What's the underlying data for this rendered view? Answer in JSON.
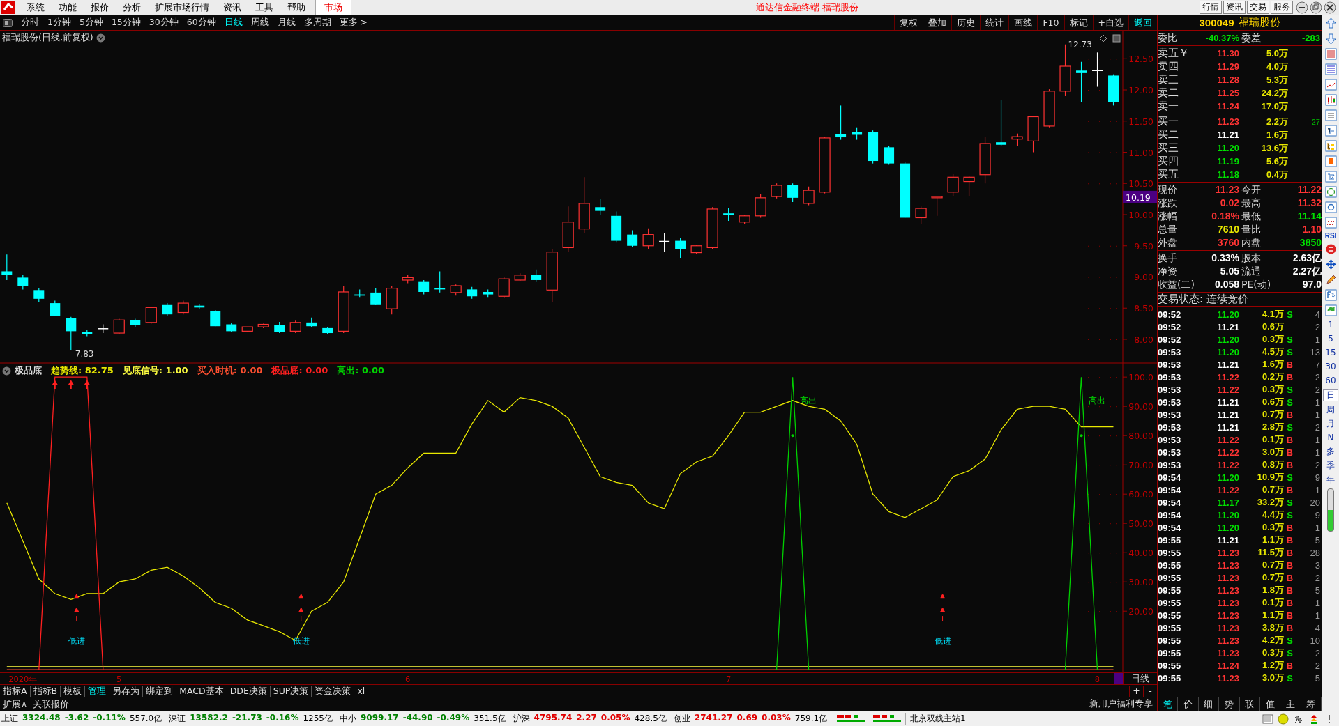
{
  "menu_bar": {
    "items": [
      "系统",
      "功能",
      "报价",
      "分析",
      "扩展市场行情",
      "资讯",
      "工具",
      "帮助"
    ],
    "market": "市场",
    "title": "通达信金融终端  福瑞股份",
    "buttons": [
      "行情",
      "资讯",
      "交易",
      "服务"
    ]
  },
  "period_bar": {
    "periods": [
      {
        "label": "分时",
        "selected": false
      },
      {
        "label": "1分钟",
        "selected": false
      },
      {
        "label": "5分钟",
        "selected": false
      },
      {
        "label": "15分钟",
        "selected": false
      },
      {
        "label": "30分钟",
        "selected": false
      },
      {
        "label": "60分钟",
        "selected": false
      },
      {
        "label": "日线",
        "selected": true
      },
      {
        "label": "周线",
        "selected": false
      },
      {
        "label": "月线",
        "selected": false
      },
      {
        "label": "多周期",
        "selected": false
      },
      {
        "label": "更多 >",
        "selected": false
      }
    ],
    "tools": [
      {
        "label": "复权",
        "selected": false
      },
      {
        "label": "叠加",
        "selected": false
      },
      {
        "label": "历史",
        "selected": false
      },
      {
        "label": "统计",
        "selected": false
      },
      {
        "label": "画线",
        "selected": false
      },
      {
        "label": "F10",
        "selected": false
      },
      {
        "label": "标记",
        "selected": false
      },
      {
        "label": "+自选",
        "selected": false
      },
      {
        "label": "返回",
        "selected": true
      }
    ]
  },
  "price_chart": {
    "title": "福瑞股份(日线,前复权)",
    "high_label": "12.73",
    "low_label": "7.83",
    "current_label": "10.19",
    "chart_data": {
      "type": "candlestick",
      "ylim": [
        7.62,
        12.95
      ],
      "yticks": [
        {
          "value": 8,
          "label": "8.00"
        },
        {
          "value": 8.5,
          "label": "8.50"
        },
        {
          "value": 9,
          "label": "9.00"
        },
        {
          "value": 9.5,
          "label": "9.50"
        },
        {
          "value": 10,
          "label": "10.00"
        },
        {
          "value": 10.5,
          "label": "10.50"
        },
        {
          "value": 11,
          "label": "11.00"
        },
        {
          "value": 11.5,
          "label": "11.50"
        },
        {
          "value": 12,
          "label": "12.00"
        },
        {
          "value": 12.5,
          "label": "12.50"
        }
      ],
      "categories": [
        null,
        null,
        null,
        null,
        null,
        null,
        null,
        null,
        null,
        null,
        null,
        null,
        null,
        null,
        null,
        null,
        null,
        null,
        null,
        null,
        null,
        null,
        null,
        null,
        null,
        null,
        null,
        null,
        null,
        null,
        null,
        null,
        null,
        null,
        null,
        null,
        null,
        null,
        null,
        null,
        null,
        null,
        null,
        null,
        null,
        null,
        null,
        null,
        null,
        null,
        null,
        null,
        null,
        null,
        null,
        null,
        null,
        null,
        null,
        null,
        null,
        null,
        null,
        null,
        null,
        null,
        null,
        null,
        null,
        null
      ],
      "ohlc": [
        [
          9.09,
          9.36,
          8.95,
          9.03
        ],
        [
          8.99,
          9.03,
          8.8,
          8.86
        ],
        [
          8.79,
          8.82,
          8.6,
          8.65
        ],
        [
          8.58,
          8.62,
          8.38,
          8.38
        ],
        [
          8.34,
          8.36,
          7.83,
          8.13
        ],
        [
          8.12,
          8.15,
          8.05,
          8.08
        ],
        [
          8.17,
          8.24,
          8.1,
          8.17
        ],
        [
          8.1,
          8.33,
          8.08,
          8.31
        ],
        [
          8.31,
          8.33,
          8.2,
          8.23
        ],
        [
          8.27,
          8.52,
          8.25,
          8.51
        ],
        [
          8.55,
          8.58,
          8.38,
          8.4
        ],
        [
          8.43,
          8.62,
          8.4,
          8.58
        ],
        [
          8.54,
          8.57,
          8.48,
          8.51
        ],
        [
          8.45,
          8.47,
          8.21,
          8.21
        ],
        [
          8.24,
          8.26,
          8.12,
          8.13
        ],
        [
          8.13,
          8.2,
          8.12,
          8.2
        ],
        [
          8.2,
          8.25,
          8.18,
          8.24
        ],
        [
          8.23,
          8.28,
          8.1,
          8.12
        ],
        [
          8.13,
          8.3,
          8.1,
          8.27
        ],
        [
          8.27,
          8.35,
          8.2,
          8.21
        ],
        [
          8.18,
          8.2,
          8.08,
          8.1
        ],
        [
          8.13,
          8.85,
          8.1,
          8.76
        ],
        [
          8.72,
          8.8,
          8.68,
          8.7
        ],
        [
          8.75,
          8.82,
          8.55,
          8.55
        ],
        [
          8.49,
          8.86,
          8.4,
          8.82
        ],
        [
          8.95,
          9.03,
          8.9,
          8.99
        ],
        [
          8.92,
          8.95,
          8.72,
          8.76
        ],
        [
          8.82,
          9.09,
          8.75,
          8.8
        ],
        [
          8.75,
          8.88,
          8.7,
          8.86
        ],
        [
          8.8,
          8.84,
          8.65,
          8.69
        ],
        [
          8.76,
          8.8,
          8.68,
          8.72
        ],
        [
          8.69,
          9.0,
          8.67,
          8.97
        ],
        [
          8.95,
          9.06,
          8.93,
          9.03
        ],
        [
          9.03,
          9.12,
          8.92,
          8.95
        ],
        [
          8.79,
          9.45,
          8.6,
          9.4
        ],
        [
          9.47,
          10.13,
          9.4,
          9.88
        ],
        [
          9.77,
          10.6,
          9.7,
          10.18
        ],
        [
          10.12,
          10.25,
          10.0,
          10.06
        ],
        [
          9.98,
          10.05,
          9.55,
          9.58
        ],
        [
          9.68,
          9.75,
          9.48,
          9.5
        ],
        [
          9.5,
          9.78,
          9.45,
          9.68
        ],
        [
          9.57,
          9.7,
          9.4,
          9.57
        ],
        [
          9.58,
          9.62,
          9.3,
          9.45
        ],
        [
          9.39,
          9.52,
          9.37,
          9.5
        ],
        [
          9.47,
          10.12,
          9.45,
          10.09
        ],
        [
          10.02,
          10.1,
          9.9,
          9.99
        ],
        [
          9.88,
          10.0,
          9.85,
          9.98
        ],
        [
          9.98,
          10.33,
          9.95,
          10.27
        ],
        [
          10.29,
          10.5,
          10.26,
          10.47
        ],
        [
          10.47,
          10.5,
          10.2,
          10.27
        ],
        [
          10.18,
          10.45,
          10.15,
          10.39
        ],
        [
          10.36,
          11.25,
          10.34,
          11.23
        ],
        [
          11.29,
          11.75,
          11.2,
          11.24
        ],
        [
          11.32,
          11.4,
          11.2,
          11.28
        ],
        [
          11.32,
          11.35,
          10.82,
          10.86
        ],
        [
          11.08,
          11.1,
          10.8,
          10.82
        ],
        [
          10.82,
          10.85,
          9.95,
          9.95
        ],
        [
          9.95,
          10.13,
          9.85,
          10.1
        ],
        [
          10.27,
          10.3,
          9.98,
          10.29
        ],
        [
          10.36,
          10.65,
          10.3,
          10.6
        ],
        [
          10.53,
          10.62,
          10.3,
          10.6
        ],
        [
          10.64,
          11.25,
          10.5,
          11.14
        ],
        [
          11.16,
          11.84,
          11.1,
          11.12
        ],
        [
          11.21,
          11.3,
          11.1,
          11.25
        ],
        [
          11.18,
          11.57,
          11.0,
          11.57
        ],
        [
          11.42,
          12.01,
          11.4,
          11.98
        ],
        [
          11.98,
          12.73,
          11.9,
          12.38
        ],
        [
          12.31,
          12.45,
          11.8,
          12.27
        ],
        [
          12.31,
          12.6,
          12.05,
          12.31
        ],
        [
          12.23,
          12.25,
          11.75,
          11.8
        ]
      ]
    }
  },
  "indicator": {
    "name": "极品底",
    "readouts": [
      ": 82.75",
      ": 1.00",
      ": 0.00",
      ": 0.00",
      ": 0.00"
    ],
    "chart_data": {
      "type": "line",
      "ylim": [
        -0.9,
        104.8
      ],
      "yticks": [
        {
          "value": 20,
          "label": "20.00"
        },
        {
          "value": 30,
          "label": "30.00"
        },
        {
          "value": 40,
          "label": "40.00"
        },
        {
          "value": 50,
          "label": "50.00"
        },
        {
          "value": 60,
          "label": "60.00"
        },
        {
          "value": 70,
          "label": "70.00"
        },
        {
          "value": 80,
          "label": "80.00"
        },
        {
          "value": 90,
          "label": "90.00"
        },
        {
          "value": 100,
          "label": "100.0"
        }
      ],
      "categories": [
        null,
        "2020年",
        null,
        null,
        null,
        null,
        null,
        "5",
        null,
        null,
        null,
        null,
        null,
        null,
        null,
        null,
        null,
        null,
        null,
        null,
        null,
        null,
        null,
        null,
        null,
        "6",
        null,
        null,
        null,
        null,
        null,
        null,
        null,
        null,
        null,
        null,
        null,
        null,
        null,
        null,
        null,
        null,
        null,
        null,
        null,
        "7",
        null,
        null,
        null,
        null,
        null,
        null,
        null,
        null,
        null,
        null,
        null,
        null,
        null,
        null,
        null,
        null,
        null,
        null,
        null,
        null,
        null,
        null,
        "8",
        null
      ],
      "series": [
        {
          "name": "趋势线",
          "color": "#e8e800",
          "values": [
            57,
            44,
            31,
            26,
            24,
            26,
            26,
            30,
            31,
            34,
            35,
            32,
            28,
            23,
            21,
            17,
            15,
            13,
            10,
            20,
            23,
            30,
            45,
            60,
            63,
            69,
            74,
            74,
            74,
            84,
            92,
            88,
            93,
            92,
            90,
            86,
            76,
            66,
            64,
            63,
            57,
            55,
            67,
            71,
            73,
            80,
            88,
            88,
            90,
            92,
            90,
            89,
            85,
            77,
            60,
            54,
            52,
            55,
            58,
            66,
            68,
            72,
            82,
            89,
            90,
            90,
            89,
            83,
            83,
            83
          ]
        },
        {
          "name": "见底信号",
          "color": "#ffff40",
          "values": [
            1,
            1,
            1,
            1,
            1,
            1,
            1,
            1,
            1,
            1,
            1,
            1,
            1,
            1,
            1,
            1,
            1,
            1,
            1,
            1,
            1,
            1,
            1,
            1,
            1,
            1,
            1,
            1,
            1,
            1,
            1,
            1,
            1,
            1,
            1,
            1,
            1,
            1,
            1,
            1,
            1,
            1,
            1,
            1,
            1,
            1,
            1,
            1,
            1,
            1,
            1,
            1,
            1,
            1,
            1,
            1,
            1,
            1,
            1,
            1,
            1,
            1,
            1,
            1,
            1,
            1,
            1,
            1,
            1,
            1
          ]
        },
        {
          "name": "买入时机",
          "color": "#ff5030",
          "values": [
            0,
            0,
            0,
            0,
            0,
            0,
            0,
            0,
            0,
            0,
            0,
            0,
            0,
            0,
            0,
            0,
            0,
            0,
            0,
            0,
            0,
            0,
            0,
            0,
            0,
            0,
            0,
            0,
            0,
            0,
            0,
            0,
            0,
            0,
            0,
            0,
            0,
            0,
            0,
            0,
            0,
            0,
            0,
            0,
            0,
            0,
            0,
            0,
            0,
            0,
            0,
            0,
            0,
            0,
            0,
            0,
            0,
            0,
            0,
            0,
            0,
            0,
            0,
            0,
            0,
            0,
            0,
            0,
            0,
            0
          ]
        },
        {
          "name": "极品底",
          "color": "#ff2020",
          "values": [
            null,
            null,
            0,
            100,
            100,
            100,
            0,
            null,
            null,
            null,
            null,
            null,
            null,
            null,
            null,
            null,
            null,
            null,
            null,
            null,
            null,
            null,
            null,
            null,
            null,
            null,
            null,
            null,
            null,
            null,
            null,
            null,
            null,
            null,
            null,
            null,
            null,
            null,
            null,
            null,
            null,
            null,
            null,
            null,
            null,
            null,
            null,
            null,
            null,
            null,
            null,
            null,
            null,
            null,
            null,
            null,
            null,
            null,
            null,
            null,
            null,
            null,
            null,
            null,
            null,
            null,
            null,
            null,
            null,
            null
          ]
        },
        {
          "name": "高出",
          "color": "#00d000",
          "values": [
            null,
            null,
            null,
            null,
            null,
            null,
            null,
            null,
            null,
            null,
            null,
            null,
            null,
            null,
            null,
            null,
            null,
            null,
            null,
            null,
            null,
            null,
            null,
            null,
            null,
            null,
            null,
            null,
            null,
            null,
            null,
            null,
            null,
            null,
            null,
            null,
            null,
            null,
            null,
            null,
            null,
            null,
            null,
            null,
            null,
            null,
            null,
            null,
            0,
            100,
            0,
            null,
            null,
            null,
            null,
            null,
            null,
            null,
            null,
            null,
            null,
            null,
            null,
            null,
            null,
            null,
            0,
            100,
            0,
            null
          ]
        }
      ],
      "annotations": [
        "低进",
        "低进",
        "低进",
        "高出",
        "高出"
      ]
    }
  },
  "date_axis": {
    "scroll": "--",
    "period": "日线",
    "zoom_in": "+",
    "zoom_out": "-"
  },
  "bottom_tabs": [
    {
      "label": "指标A",
      "selected": false
    },
    {
      "label": "指标B",
      "selected": false
    },
    {
      "label": "模板",
      "selected": false
    },
    {
      "label": "管理",
      "selected": true
    },
    {
      "label": "另存为",
      "selected": false
    },
    {
      "label": "绑定到",
      "selected": false
    },
    {
      "label": "MACD基本",
      "selected": false
    },
    {
      "label": "DDE决策",
      "selected": false
    },
    {
      "label": "SUP决策",
      "selected": false
    },
    {
      "label": "资金决策",
      "selected": false
    },
    {
      "label": "xl",
      "selected": false
    }
  ],
  "extra_tabs": [
    "扩展∧",
    "关联报价"
  ],
  "promo": "新用户福利专享",
  "quote": {
    "code": "300049",
    "name": "福瑞股份",
    "ratio_label": "委比",
    "ratio": "-40.37%",
    "diff_label": "委差",
    "diff": "-283",
    "asks": [
      {
        "label": "卖五￥",
        "price": "11.30",
        "color": "#ff3434",
        "volume": "5.0万"
      },
      {
        "label": "卖四",
        "price": "11.29",
        "color": "#ff3434",
        "volume": "4.0万"
      },
      {
        "label": "卖三",
        "price": "11.28",
        "color": "#ff3434",
        "volume": "5.3万"
      },
      {
        "label": "卖二",
        "price": "11.25",
        "color": "#ff3434",
        "volume": "24.2万"
      },
      {
        "label": "卖一",
        "price": "11.24",
        "color": "#ff3434",
        "volume": "17.0万"
      }
    ],
    "bids": [
      {
        "label": "买一",
        "price": "11.23",
        "color": "#ff3434",
        "volume": "2.2万",
        "change": "-27"
      },
      {
        "label": "买二",
        "price": "11.21",
        "color": "#ffffff",
        "volume": "1.6万"
      },
      {
        "label": "买三",
        "price": "11.20",
        "color": "#00e000",
        "volume": "13.6万"
      },
      {
        "label": "买四",
        "price": "11.19",
        "color": "#00e000",
        "volume": "5.6万"
      },
      {
        "label": "买五",
        "price": "11.18",
        "color": "#00e000",
        "volume": "0.4万"
      }
    ],
    "stats": [
      {
        "label": "现价",
        "value": "11.23",
        "color": "#ff3434"
      },
      {
        "label": "今开",
        "value": "11.22",
        "color": "#ff3434"
      },
      {
        "label": "涨跌",
        "value": "0.02",
        "color": "#ff3434"
      },
      {
        "label": "最高",
        "value": "11.32",
        "color": "#ff3434"
      },
      {
        "label": "涨幅",
        "value": "0.18%",
        "color": "#ff3434"
      },
      {
        "label": "最低",
        "value": "11.14",
        "color": "#00e000"
      },
      {
        "label": "总量",
        "value": "7610",
        "color": "#e8e800"
      },
      {
        "label": "量比",
        "value": "1.10",
        "color": "#ff3434"
      },
      {
        "label": "外盘",
        "value": "3760",
        "color": "#ff3434"
      },
      {
        "label": "内盘",
        "value": "3850",
        "color": "#00e000"
      }
    ],
    "stats2": [
      {
        "label": "换手",
        "value": "0.33%",
        "color": "#ffffff"
      },
      {
        "label": "股本",
        "value": "2.63亿",
        "color": "#ffffff"
      },
      {
        "label": "净资",
        "value": "5.05",
        "color": "#ffffff"
      },
      {
        "label": "流通",
        "value": "2.27亿",
        "color": "#ffffff"
      },
      {
        "label": "收益(二)",
        "value": "0.058",
        "color": "#ffffff"
      },
      {
        "label": "PE(动)",
        "value": "97.0",
        "color": "#ffffff"
      }
    ],
    "status": "交易状态: 连续竞价"
  },
  "ticks": [
    {
      "time": "09:52",
      "price": "11.20",
      "color": "#00e000",
      "volume": "4.1万",
      "side": {
        "text": "S",
        "color": "#00e000"
      },
      "count": "4"
    },
    {
      "time": "09:52",
      "price": "11.21",
      "color": "#ffffff",
      "volume": "0.6万",
      "count": "2"
    },
    {
      "time": "09:52",
      "price": "11.20",
      "color": "#00e000",
      "volume": "0.3万",
      "side": {
        "text": "S",
        "color": "#00e000"
      },
      "count": "1"
    },
    {
      "time": "09:53",
      "price": "11.20",
      "color": "#00e000",
      "volume": "4.5万",
      "side": {
        "text": "S",
        "color": "#00e000"
      },
      "count": "13"
    },
    {
      "time": "09:53",
      "price": "11.21",
      "color": "#ffffff",
      "volume": "1.6万",
      "side": {
        "text": "B",
        "color": "#ff3434"
      },
      "count": "7"
    },
    {
      "time": "09:53",
      "price": "11.22",
      "color": "#ff3434",
      "volume": "0.2万",
      "side": {
        "text": "B",
        "color": "#ff3434"
      },
      "count": "2"
    },
    {
      "time": "09:53",
      "price": "11.22",
      "color": "#ff3434",
      "volume": "0.3万",
      "side": {
        "text": "S",
        "color": "#00e000"
      },
      "count": "2"
    },
    {
      "time": "09:53",
      "price": "11.21",
      "color": "#ffffff",
      "volume": "0.6万",
      "side": {
        "text": "S",
        "color": "#00e000"
      },
      "count": "1"
    },
    {
      "time": "09:53",
      "price": "11.21",
      "color": "#ffffff",
      "volume": "0.7万",
      "side": {
        "text": "B",
        "color": "#ff3434"
      },
      "count": "1"
    },
    {
      "time": "09:53",
      "price": "11.21",
      "color": "#ffffff",
      "volume": "2.8万",
      "side": {
        "text": "S",
        "color": "#00e000"
      },
      "count": "2"
    },
    {
      "time": "09:53",
      "price": "11.22",
      "color": "#ff3434",
      "volume": "0.1万",
      "side": {
        "text": "B",
        "color": "#ff3434"
      },
      "count": "1"
    },
    {
      "time": "09:53",
      "price": "11.22",
      "color": "#ff3434",
      "volume": "3.0万",
      "side": {
        "text": "B",
        "color": "#ff3434"
      },
      "count": "1"
    },
    {
      "time": "09:53",
      "price": "11.22",
      "color": "#ff3434",
      "volume": "0.8万",
      "side": {
        "text": "B",
        "color": "#ff3434"
      },
      "count": "2"
    },
    {
      "time": "09:54",
      "price": "11.20",
      "color": "#00e000",
      "volume": "10.9万",
      "side": {
        "text": "S",
        "color": "#00e000"
      },
      "count": "9"
    },
    {
      "time": "09:54",
      "price": "11.22",
      "color": "#ff3434",
      "volume": "0.7万",
      "side": {
        "text": "B",
        "color": "#ff3434"
      },
      "count": "1"
    },
    {
      "time": "09:54",
      "price": "11.17",
      "color": "#00e000",
      "volume": "33.2万",
      "side": {
        "text": "S",
        "color": "#00e000"
      },
      "count": "20"
    },
    {
      "time": "09:54",
      "price": "11.20",
      "color": "#00e000",
      "volume": "4.4万",
      "side": {
        "text": "S",
        "color": "#00e000"
      },
      "count": "9"
    },
    {
      "time": "09:54",
      "price": "11.20",
      "color": "#00e000",
      "volume": "0.3万",
      "side": {
        "text": "B",
        "color": "#ff3434"
      },
      "count": "1"
    },
    {
      "time": "09:55",
      "price": "11.21",
      "color": "#ffffff",
      "volume": "1.1万",
      "side": {
        "text": "B",
        "color": "#ff3434"
      },
      "count": "5"
    },
    {
      "time": "09:55",
      "price": "11.23",
      "color": "#ff3434",
      "volume": "11.5万",
      "side": {
        "text": "B",
        "color": "#ff3434"
      },
      "count": "28"
    },
    {
      "time": "09:55",
      "price": "11.23",
      "color": "#ff3434",
      "volume": "0.7万",
      "side": {
        "text": "B",
        "color": "#ff3434"
      },
      "count": "3"
    },
    {
      "time": "09:55",
      "price": "11.23",
      "color": "#ff3434",
      "volume": "0.7万",
      "side": {
        "text": "B",
        "color": "#ff3434"
      },
      "count": "2"
    },
    {
      "time": "09:55",
      "price": "11.23",
      "color": "#ff3434",
      "volume": "1.8万",
      "side": {
        "text": "B",
        "color": "#ff3434"
      },
      "count": "5"
    },
    {
      "time": "09:55",
      "price": "11.23",
      "color": "#ff3434",
      "volume": "0.1万",
      "side": {
        "text": "B",
        "color": "#ff3434"
      },
      "count": "1"
    },
    {
      "time": "09:55",
      "price": "11.23",
      "color": "#ff3434",
      "volume": "1.1万",
      "side": {
        "text": "B",
        "color": "#ff3434"
      },
      "count": "1"
    },
    {
      "time": "09:55",
      "price": "11.23",
      "color": "#ff3434",
      "volume": "3.8万",
      "side": {
        "text": "B",
        "color": "#ff3434"
      },
      "count": "4"
    },
    {
      "time": "09:55",
      "price": "11.23",
      "color": "#ff3434",
      "volume": "4.2万",
      "side": {
        "text": "S",
        "color": "#00e000"
      },
      "count": "10"
    },
    {
      "time": "09:55",
      "price": "11.23",
      "color": "#ff3434",
      "volume": "0.3万",
      "side": {
        "text": "S",
        "color": "#00e000"
      },
      "count": "2"
    },
    {
      "time": "09:55",
      "price": "11.24",
      "color": "#ff3434",
      "volume": "1.2万",
      "side": {
        "text": "B",
        "color": "#ff3434"
      },
      "count": "2"
    },
    {
      "time": "09:55",
      "price": "11.23",
      "color": "#ff3434",
      "volume": "3.0万",
      "side": {
        "text": "S",
        "color": "#00e000"
      },
      "count": "5"
    }
  ],
  "quote_tabs": [
    {
      "label": "笔",
      "selected": true
    },
    {
      "label": "价",
      "selected": false
    },
    {
      "label": "细",
      "selected": false
    },
    {
      "label": "势",
      "selected": false
    },
    {
      "label": "联",
      "selected": false
    },
    {
      "label": "值",
      "selected": false
    },
    {
      "label": "主",
      "selected": false
    },
    {
      "label": "筹",
      "selected": false
    }
  ],
  "side_tools": {
    "rsi": "RSI",
    "periods": [
      {
        "label": "1",
        "selected": false
      },
      {
        "label": "5",
        "selected": false
      },
      {
        "label": "15",
        "selected": false
      },
      {
        "label": "30",
        "selected": false
      },
      {
        "label": "60",
        "selected": false
      },
      {
        "label": "日",
        "selected": true
      },
      {
        "label": "周",
        "selected": false
      },
      {
        "label": "月",
        "selected": false
      },
      {
        "label": "N",
        "selected": false
      },
      {
        "label": "多",
        "selected": false
      },
      {
        "label": "季",
        "selected": false
      },
      {
        "label": "年",
        "selected": false
      }
    ]
  },
  "status_bar": {
    "indices": [
      {
        "name": "上证",
        "value": "3324.48",
        "change": "-3.62",
        "percent": "-0.11%",
        "amount": "557.0亿",
        "color": "#008000"
      },
      {
        "name": "深证",
        "value": "13582.2",
        "change": "-21.73",
        "percent": "-0.16%",
        "amount": "1255亿",
        "color": "#008000"
      },
      {
        "name": "中小",
        "value": "9099.17",
        "change": "-44.90",
        "percent": "-0.49%",
        "amount": "351.5亿",
        "color": "#008000"
      },
      {
        "name": "沪深",
        "value": "4795.74",
        "change": "2.27",
        "percent": "0.05%",
        "amount": "428.5亿",
        "color": "#e00000"
      },
      {
        "name": "创业",
        "value": "2741.27",
        "change": "0.69",
        "percent": "0.03%",
        "amount": "759.1亿",
        "color": "#e00000"
      }
    ],
    "server": "北京双线主站1"
  }
}
